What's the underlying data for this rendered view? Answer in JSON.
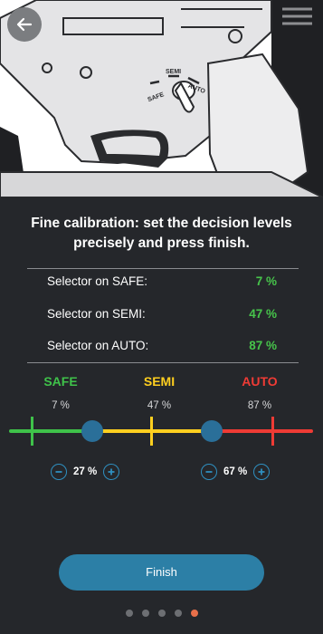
{
  "hero": {
    "back_icon": "arrow-left-icon",
    "selector_labels": {
      "safe": "SAFE",
      "semi": "SEMI",
      "auto": "AUTO"
    }
  },
  "title": "Fine calibration: set the decision levels precisely and press finish.",
  "readings": [
    {
      "label": "Selector on SAFE:",
      "value": "7 %"
    },
    {
      "label": "Selector on SEMI:",
      "value": "47 %"
    },
    {
      "label": "Selector on AUTO:",
      "value": "87 %"
    }
  ],
  "zones": [
    {
      "label": "SAFE",
      "pct": "7 %",
      "color": "#3fc24a"
    },
    {
      "label": "SEMI",
      "pct": "47 %",
      "color": "#ffcf1f"
    },
    {
      "label": "AUTO",
      "pct": "87 %",
      "color": "#ef3b35"
    }
  ],
  "thresholds": [
    {
      "value": 27,
      "display": "27 %"
    },
    {
      "value": 67,
      "display": "67 %"
    }
  ],
  "finish_label": "Finish",
  "pagination": {
    "count": 5,
    "active": 4
  },
  "colors": {
    "background": "#25272b",
    "accent": "#2c7fa6",
    "value_green": "#47c44b",
    "handle": "#2a6f99"
  }
}
